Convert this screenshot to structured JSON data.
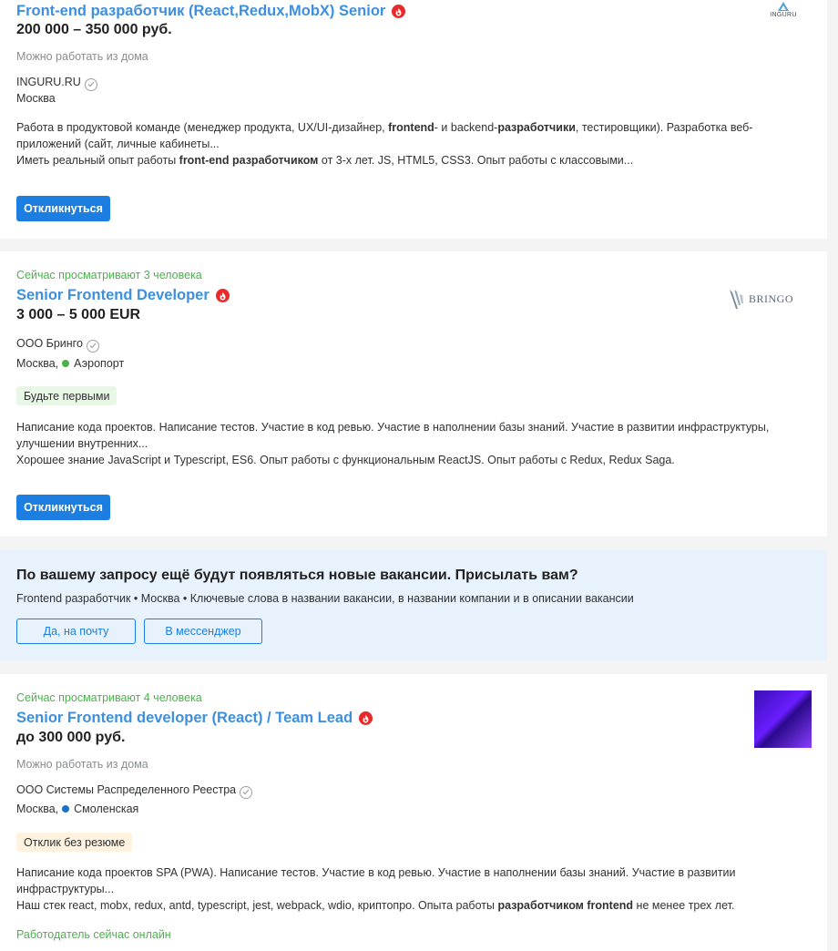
{
  "vacancies": [
    {
      "title": "Front-end разработчик (React,Redux,MobX) Senior",
      "salary": "200 000 – 350 000 руб.",
      "remote": "Можно работать из дома",
      "company": "INGURU.RU",
      "city": "Москва",
      "logo_text": "INGURU",
      "desc_line1_a": "Работа в продуктовой команде (менеджер продукта, UX/UI-дизайнер, ",
      "desc_line1_b": "frontend",
      "desc_line1_c": "- и backend-",
      "desc_line1_d": "разработчики",
      "desc_line1_e": ", тестировщики). Разработка веб-",
      "desc_line2": "приложений (сайт, личные кабинеты...",
      "desc_line3_a": "Иметь реальный опыт работы ",
      "desc_line3_b": "front-end разработчиком",
      "desc_line3_c": " от 3-х лет. JS, HTML5, CSS3. Опыт работы с классовыми...",
      "apply": "Откликнуться"
    },
    {
      "viewers": "Сейчас просматривают 3 человека",
      "title": "Senior Frontend Developer",
      "salary": "3 000 – 5 000 EUR",
      "company": "ООО Бринго",
      "city": "Москва,",
      "metro": "Аэропорт",
      "metro_color": "#4bb24b",
      "logo_text": "BRINGO",
      "badge": "Будьте первыми",
      "desc_line1": "Написание кода проектов. Написание тестов. Участие в код ревью. Участие в наполнении базы знаний. Участие в развитии инфраструктуры,",
      "desc_line2": "улучшении внутренних...",
      "desc_line3": "Хорошее знание JavaScript и Typescript, ES6. Опыт работы с функциональным ReactJS. Опыт работы с Redux, Redux Saga.",
      "apply": "Откликнуться"
    },
    {
      "viewers": "Сейчас просматривают 4 человека",
      "title": "Senior Frontend developer (React) / Team Lead",
      "salary": "до 300 000 руб.",
      "remote": "Можно работать из дома",
      "company": "ООО Системы Распределенного Реестра",
      "city": "Москва,",
      "metro": "Смоленская",
      "metro_color": "#1c73c4",
      "badge": "Отклик без резюме",
      "desc_line1": "Написание кода проектов SPA (PWA). Написание тестов. Участие в код ревью. Участие в наполнении базы знаний. Участие в развитии",
      "desc_line2": "инфраструктуры...",
      "desc_line3_a": "Наш стек react, mobx, redux, antd, typescript, jest, webpack, wdio, криптопро. Опыта работы ",
      "desc_line3_b": "разработчиком frontend",
      "desc_line3_c": " не менее трех лет.",
      "online": "Работодатель сейчас онлайн"
    }
  ],
  "subscribe": {
    "heading": "По вашему запросу ещё будут появляться новые вакансии. Присылать вам?",
    "query": "Frontend разработчик • Москва • Ключевые слова в названии вакансии, в названии компании и в описании вакансии",
    "email_button": "Да, на почту",
    "messenger_button": "В мессенджер"
  },
  "colors": {
    "link": "#3d8fe0",
    "primary_button": "#1b7ee0",
    "hot_badge": "#ea2a2a",
    "online_green": "#4bb24b",
    "promo_bg": "#e8f2fc"
  },
  "icons": [
    "fire-icon",
    "verified-check-icon",
    "metro-dot-icon"
  ]
}
